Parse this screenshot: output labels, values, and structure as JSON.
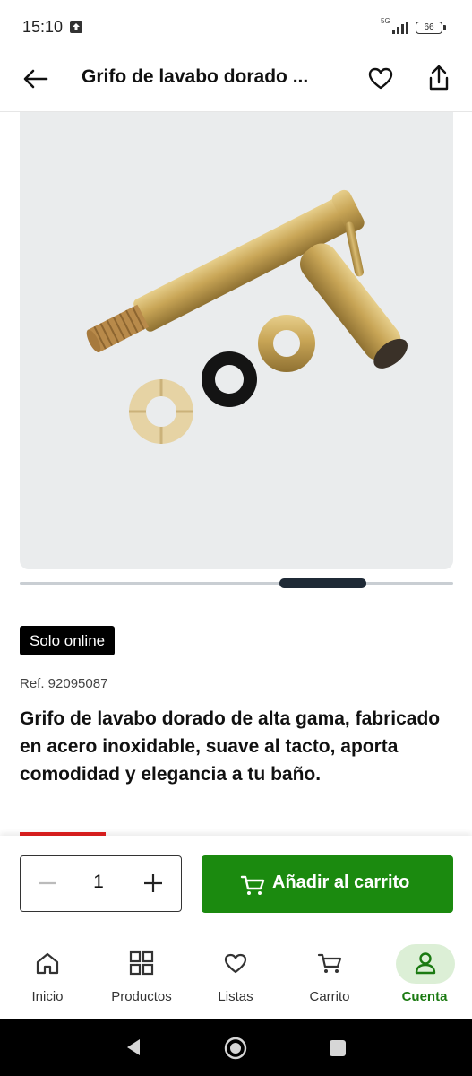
{
  "status_bar": {
    "time": "15:10",
    "network": "5G",
    "battery": "66"
  },
  "header": {
    "title": "Grifo de lavabo dorado ..."
  },
  "product": {
    "badge": "Solo online",
    "ref": "Ref. 92095087",
    "description": "Grifo de lavabo dorado de alta gama, fabricado en acero inoxidable, suave al tacto, aporta comodidad y elegancia a tu baño."
  },
  "purchase": {
    "quantity": "1",
    "add_to_cart_label": "Añadir al carrito"
  },
  "bottom_nav": {
    "items": [
      {
        "label": "Inicio",
        "icon": "home-icon"
      },
      {
        "label": "Productos",
        "icon": "grid-icon"
      },
      {
        "label": "Listas",
        "icon": "heart-icon"
      },
      {
        "label": "Carrito",
        "icon": "cart-icon"
      },
      {
        "label": "Cuenta",
        "icon": "user-icon",
        "active": true
      }
    ]
  },
  "colors": {
    "primary_green": "#1b8a0f",
    "active_green": "#1b7a12",
    "active_bg": "#dcefd6",
    "accent_red": "#e02020"
  }
}
